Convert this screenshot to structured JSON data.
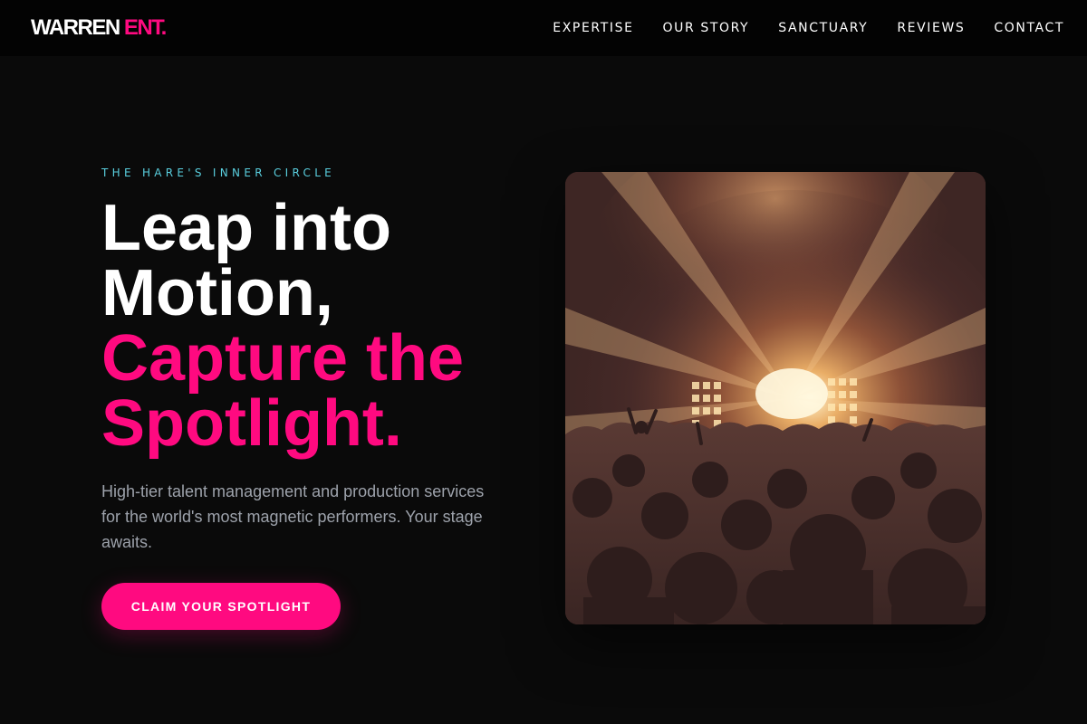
{
  "header": {
    "logo_main": "WARREN",
    "logo_accent": "ENT.",
    "nav": [
      {
        "label": "EXPERTISE"
      },
      {
        "label": "OUR STORY"
      },
      {
        "label": "SANCTUARY"
      },
      {
        "label": "REVIEWS"
      },
      {
        "label": "CONTACT"
      }
    ]
  },
  "hero": {
    "eyebrow": "THE HARE'S INNER CIRCLE",
    "headline_lines": [
      "Leap into",
      "Motion,",
      "Capture the",
      "Spotlight."
    ],
    "subtext": "High-tier talent management and production services for the world's most magnetic performers. Your stage awaits.",
    "cta_label": "CLAIM YOUR SPOTLIGHT"
  },
  "colors": {
    "accent": "#ff0a80",
    "eyebrow": "#5ad0e0",
    "background": "#0a0a0a"
  }
}
